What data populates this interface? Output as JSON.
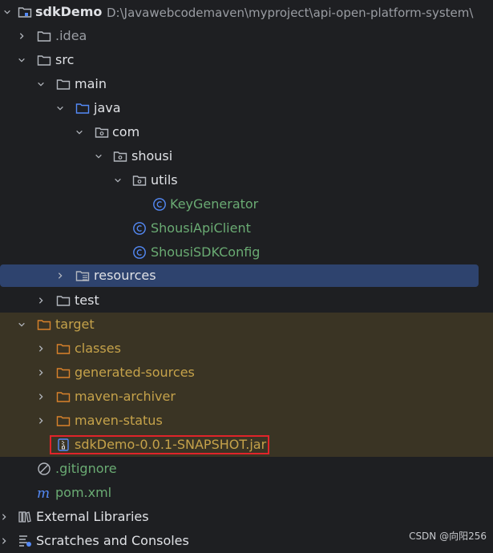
{
  "project": {
    "name": "sdkDemo",
    "path": "D:\\Javawebcodemaven\\myproject\\api-open-platform-system\\"
  },
  "tree": {
    "idea": ".idea",
    "src": "src",
    "main": "main",
    "java": "java",
    "com": "com",
    "shousi": "shousi",
    "utils": "utils",
    "key_generator": "KeyGenerator",
    "api_client": "ShousiApiClient",
    "sdk_config": "ShousiSDKConfig",
    "resources": "resources",
    "test": "test",
    "target": "target",
    "classes": "classes",
    "generated_sources": "generated-sources",
    "maven_archiver": "maven-archiver",
    "maven_status": "maven-status",
    "jar": "sdkDemo-0.0.1-SNAPSHOT.jar",
    "gitignore": ".gitignore",
    "pom": "pom.xml",
    "external_libraries": "External Libraries",
    "scratches": "Scratches and Consoles"
  },
  "watermark": "CSDN @向阳256",
  "colors": {
    "background": "#1e1f22",
    "selection": "#2e436e",
    "excluded_zone": "#3a3424",
    "excluded_text": "#c5a24a",
    "class_icon": "#548af7",
    "highlight_border": "#e0242a"
  }
}
